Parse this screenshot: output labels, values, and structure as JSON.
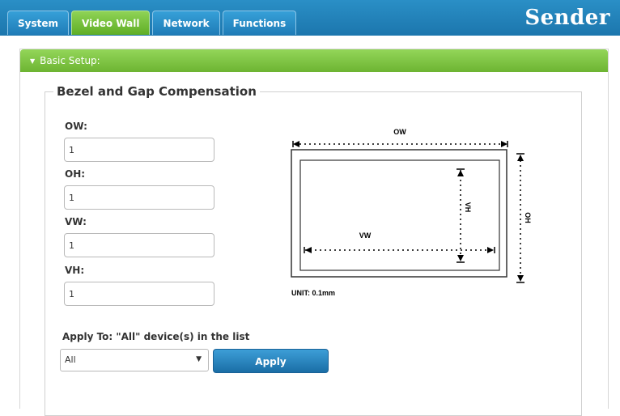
{
  "tabs": [
    {
      "label": "System",
      "active": false
    },
    {
      "label": "Video Wall",
      "active": true
    },
    {
      "label": "Network",
      "active": false
    },
    {
      "label": "Functions",
      "active": false
    }
  ],
  "brand": "Sender",
  "panel": {
    "title": "Basic Setup:"
  },
  "section": {
    "title": "Bezel and Gap Compensation",
    "fields": [
      {
        "label": "OW:",
        "value": "1"
      },
      {
        "label": "OH:",
        "value": "1"
      },
      {
        "label": "VW:",
        "value": "1"
      },
      {
        "label": "VH:",
        "value": "1"
      }
    ]
  },
  "diagram": {
    "ow_label": "OW",
    "oh_label": "OH",
    "vw_label": "VW",
    "vh_label": "VH",
    "unit_label": "UNIT: 0.1mm"
  },
  "apply": {
    "label": "Apply To: \"All\" device(s) in the list",
    "select_value": "All",
    "button_label": "Apply"
  },
  "colors": {
    "topbar": "#1f7cb7",
    "active_tab": "#6db432",
    "panel_header": "#7dc443",
    "button": "#2a86c2"
  },
  "icons": {
    "panel_toggle": "triangle-down-icon",
    "select_caret": "caret-down-icon"
  }
}
